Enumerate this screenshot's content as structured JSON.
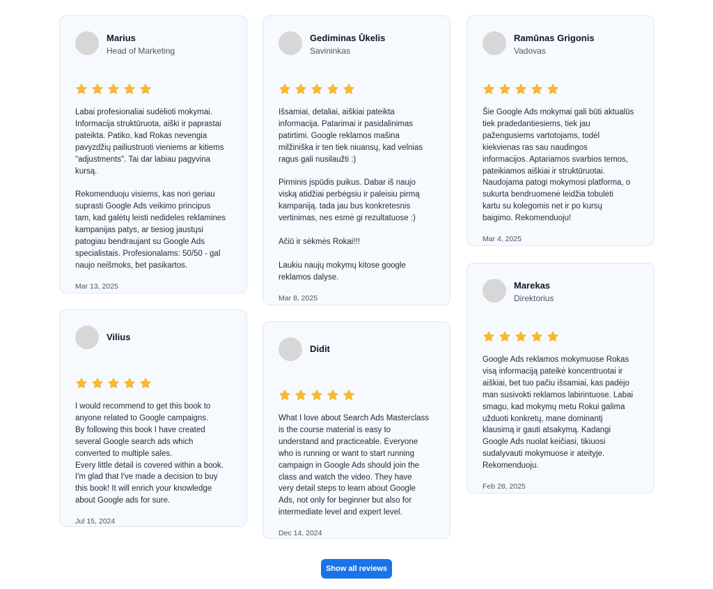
{
  "colors": {
    "accent": "#1a73e8",
    "star": "#f8b832",
    "card_bg": "#f6f9fd",
    "avatar": "#d7d7d7"
  },
  "reviews": [
    {
      "name": "Marius",
      "role": "Head of Marketing",
      "rating": 5,
      "text": "Labai profesionaliai sudėlioti mokymai.\nInformacija struktūruota, aiški ir paprastai\npateikta. Patiko, kad Rokas nevengia\npavyzdžių pailiustruoti vieniems ar kitiems\n\"adjustments\". Tai dar labiau pagyvina\nkursą.\n\nRekomenduoju visiems, kas nori geriau\nsuprasti Google Ads veikimo principus\ntam, kad galėtų leisti nedideles reklamines\nkampanijas patys, ar tiesiog jaustųsi\npatogiau bendraujant su Google Ads\nspecialistais. Profesionalams: 50/50 - gal\nnaujo neišmoks, bet pasikartos.",
      "date": "Mar 13, 2025"
    },
    {
      "name": "Vilius",
      "role": "",
      "rating": 5,
      "text": "I would recommend to get this book to\nanyone related to Google campaigns.\nBy following this book I have created\nseveral Google search ads which\nconverted to multiple sales.\nEvery little detail is covered within a book.\nI'm glad that I've made a decision to buy\nthis book! It will enrich your knowledge\nabout Google ads for sure.",
      "date": "Jul 15, 2024"
    },
    {
      "name": "Gediminas Ūkelis",
      "role": "Savininkas",
      "rating": 5,
      "text": "Išsamiai, detaliai, aiškiai pateikta\ninformacija. Patarimai ir pasidalinimas\npatirtimi. Google reklamos mašina\nmilžiniška ir ten tiek niuansų, kad velnias\nragus gali nusilaužti :)\n\nPirminis įspūdis puikus. Dabar iš naujo\nviską atidžiai perbėgsiu ir paleisiu pirmą\nkampaniją. tada jau bus konkretesnis\nvertinimas, nes esmė gi rezultatuose :)\n\nAčiū ir sėkmės Rokai!!!\n\nLaukiu naujų mokymų kitose google\nreklamos dalyse.",
      "date": "Mar 8, 2025"
    },
    {
      "name": "Didit",
      "role": "",
      "rating": 5,
      "text": "What I love about Search Ads Masterclass\nis the course material is easy to\nunderstand and practiceable. Everyone\nwho is running or want to start running\ncampaign in Google Ads should join the\nclass and watch the video. They have\nvery detail steps to learn about Google\nAds, not only for beginner but also for\nintermediate level and expert level.",
      "date": "Dec 14, 2024"
    },
    {
      "name": "Ramūnas Grigonis",
      "role": "Vadovas",
      "rating": 5,
      "text": "Šie Google Ads mokymai gali būti aktualūs\ntiek pradedantiesiems, tiek jau\npažengusiems vartotojams, todėl\nkiekvienas ras sau naudingos\ninformacijos. Aptariamos svarbios temos,\npateikiamos aiškiai ir struktūruotai.\nNaudojama patogi mokymosi platforma, o\nsukurta bendruomenė leidžia tobulėti\nkartu su kolegomis net ir po kursų\nbaigimo. Rekomenduoju!",
      "date": "Mar 4, 2025"
    },
    {
      "name": "Marekas",
      "role": "Direktorius",
      "rating": 5,
      "text": "Google Ads reklamos mokymuose Rokas\nvisą informaciją pateikė koncentruotai ir\naiškiai, bet tuo pačiu išsamiai, kas padėjo\nman susivokti reklamos labirintuose. Labai\nsmagu, kad mokymų metu Rokui galima\nužduoti konkretų, mane dominantį\nklausimą ir gauti atsakymą. Kadangi\nGoogle Ads nuolat keičiasi, tikiuosi\nsudalyvauti mokymuose ir ateityje.\nRekomenduoju.",
      "date": "Feb 28, 2025"
    }
  ],
  "footer": {
    "show_all_label": "Show all reviews"
  }
}
